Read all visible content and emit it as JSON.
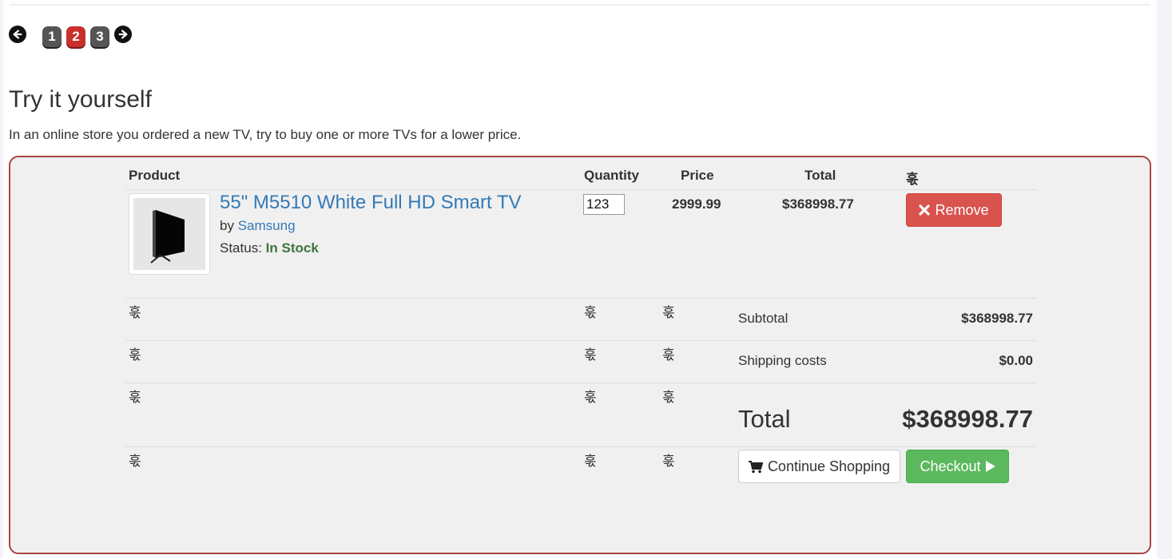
{
  "pagination": {
    "prev_icon": "arrow-left-circle-icon",
    "next_icon": "arrow-right-circle-icon",
    "pages": [
      "1",
      "2",
      "3"
    ],
    "active_page": "2"
  },
  "section": {
    "title": "Try it yourself",
    "description": "In an online store you ordered a new TV, try to buy one or more TVs for a lower price."
  },
  "cart": {
    "headers": {
      "product": "Product",
      "quantity": "Quantity",
      "price": "Price",
      "total": "Total",
      "extra": "훇"
    },
    "item": {
      "name": "55\" M5510 White Full HD Smart TV",
      "by_label": "by",
      "brand": "Samsung",
      "status_label": "Status:",
      "status_value": "In Stock",
      "quantity": "123",
      "price": "2999.99",
      "total": "$368998.77",
      "remove_label": "Remove",
      "image_icon": "tv-product-image"
    },
    "placeholder_glyph": "훇",
    "summary": {
      "subtotal_label": "Subtotal",
      "subtotal_value": "$368998.77",
      "shipping_label": "Shipping costs",
      "shipping_value": "$0.00",
      "total_label": "Total",
      "total_value": "$368998.77"
    },
    "actions": {
      "continue_label": "Continue Shopping",
      "checkout_label": "Checkout"
    }
  },
  "colors": {
    "danger": "#d9534f",
    "success": "#5cb85c",
    "link": "#337ab7",
    "in_stock": "#3c763d",
    "box_border": "#a94442",
    "active_page": "#c9302c"
  }
}
